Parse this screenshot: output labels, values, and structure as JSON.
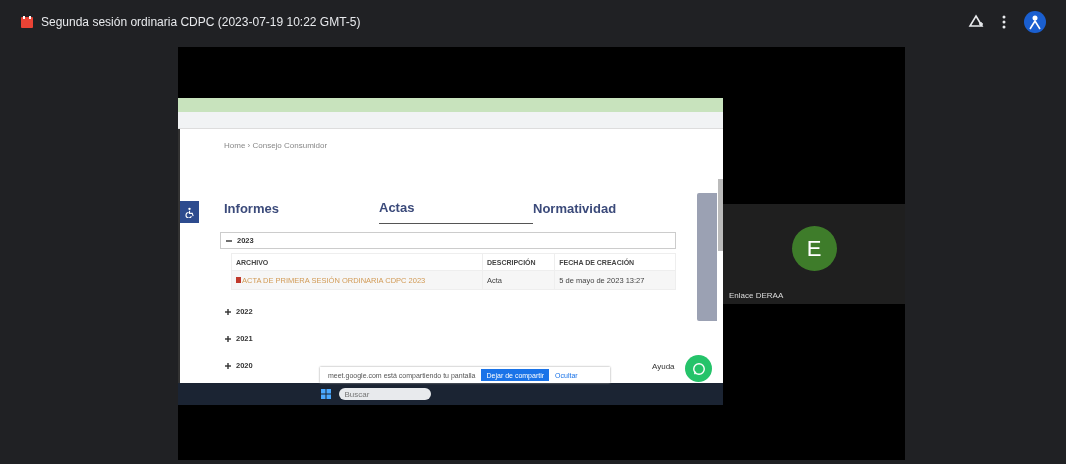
{
  "meeting": {
    "title": "Segunda sesión ordinaria CDPC (2023-07-19 10:22 GMT-5)"
  },
  "shared_screen": {
    "breadcrumb": "Home › Consejo Consumidor",
    "tabs": [
      {
        "label": "Informes",
        "selected": false
      },
      {
        "label": "Actas",
        "selected": true
      },
      {
        "label": "Normatividad",
        "selected": false
      }
    ],
    "sections": [
      {
        "year": "2023",
        "expanded": true,
        "columns": [
          "ARCHIVO",
          "DESCRIPCIÓN",
          "FECHA DE CREACIÓN"
        ],
        "rows": [
          {
            "archivo": "ACTA DE PRIMERA SESIÓN ORDINARIA CDPC 2023",
            "descripcion": "Acta",
            "fecha": "5 de mayo de 2023 13:27"
          }
        ]
      },
      {
        "year": "2022",
        "expanded": false
      },
      {
        "year": "2021",
        "expanded": false
      },
      {
        "year": "2020",
        "expanded": false
      }
    ],
    "help_label": "Ayuda",
    "share_notice": {
      "text": "meet.google.com está compartiendo tu pantalla",
      "stop_button": "Dejar de compartir",
      "hide_link": "Ocultar"
    },
    "taskbar": {
      "search_placeholder": "Buscar"
    }
  },
  "participant": {
    "initial": "E",
    "name": "Enlace DERAA"
  }
}
